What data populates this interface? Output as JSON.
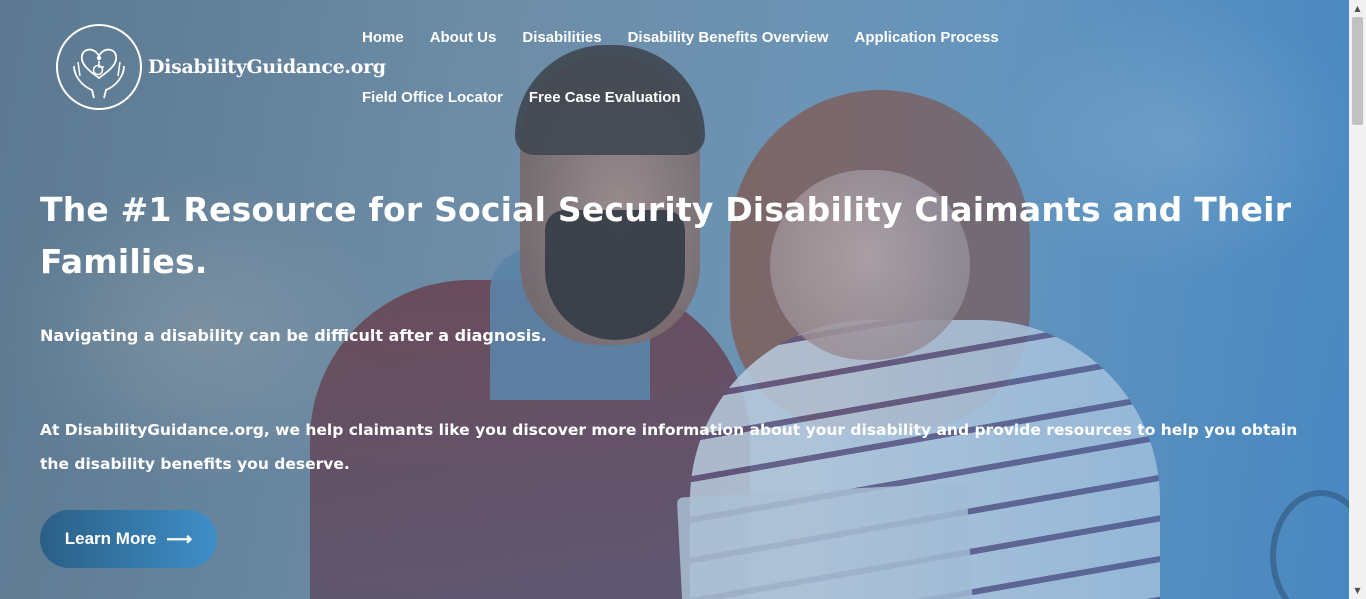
{
  "logo": {
    "text": "DisabilityGuidance.org",
    "icon": "hands-heart-wheelchair-icon"
  },
  "nav": {
    "items": [
      {
        "label": "Home"
      },
      {
        "label": "About Us"
      },
      {
        "label": "Disabilities"
      },
      {
        "label": "Disability Benefits Overview"
      },
      {
        "label": "Application Process"
      },
      {
        "label": "Field Office Locator"
      },
      {
        "label": "Free Case Evaluation"
      }
    ]
  },
  "hero": {
    "headline": "The #1 Resource for Social Security Disability Claimants and Their Families.",
    "subheading": "Navigating a disability can be difficult after a diagnosis.",
    "body": "At DisabilityGuidance.org, we help claimants like you discover more information about your disability and provide resources to help you obtain the disability benefits you deserve.",
    "cta_label": "Learn More",
    "cta_icon": "arrow-right-icon"
  },
  "colors": {
    "accent": "#3f8fc8",
    "text": "#ffffff",
    "overlay": "#5a7b96"
  },
  "scrollbar": {
    "up_icon": "scroll-up-arrow-icon",
    "down_icon": "scroll-down-arrow-icon"
  }
}
